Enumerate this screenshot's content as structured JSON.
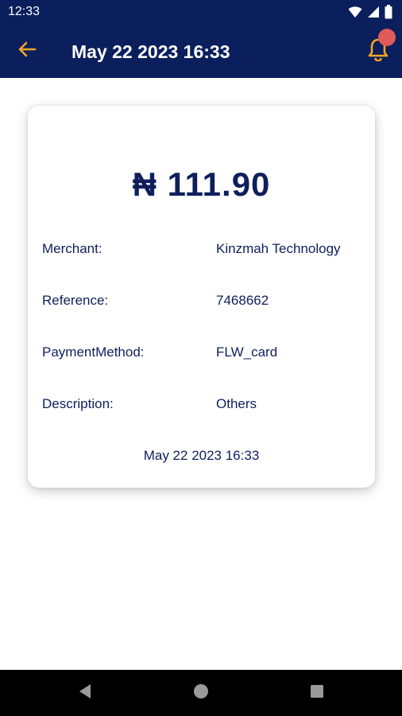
{
  "status_bar": {
    "time": "12:33",
    "icons": [
      "wifi-icon",
      "signal-icon",
      "battery-icon"
    ]
  },
  "app_bar": {
    "title": "May 22 2023 16:33",
    "back_icon": "arrow-left-icon",
    "bell_icon": "bell-icon",
    "colors": {
      "bar": "#0a1f5c",
      "accent": "#f5a623",
      "notification_dot": "#e05a5a"
    }
  },
  "receipt": {
    "amount": "₦ 111.90",
    "rows": [
      {
        "label": "Merchant:",
        "value": "Kinzmah Technology"
      },
      {
        "label": "Reference:",
        "value": "7468662"
      },
      {
        "label": "PaymentMethod:",
        "value": "FLW_card"
      },
      {
        "label": "Description:",
        "value": "Others"
      }
    ],
    "date": "May 22 2023 16:33",
    "text_color": "#0f1f5c"
  },
  "nav_bar": {
    "items": [
      "back-triangle-icon",
      "home-circle-icon",
      "recents-square-icon"
    ]
  }
}
